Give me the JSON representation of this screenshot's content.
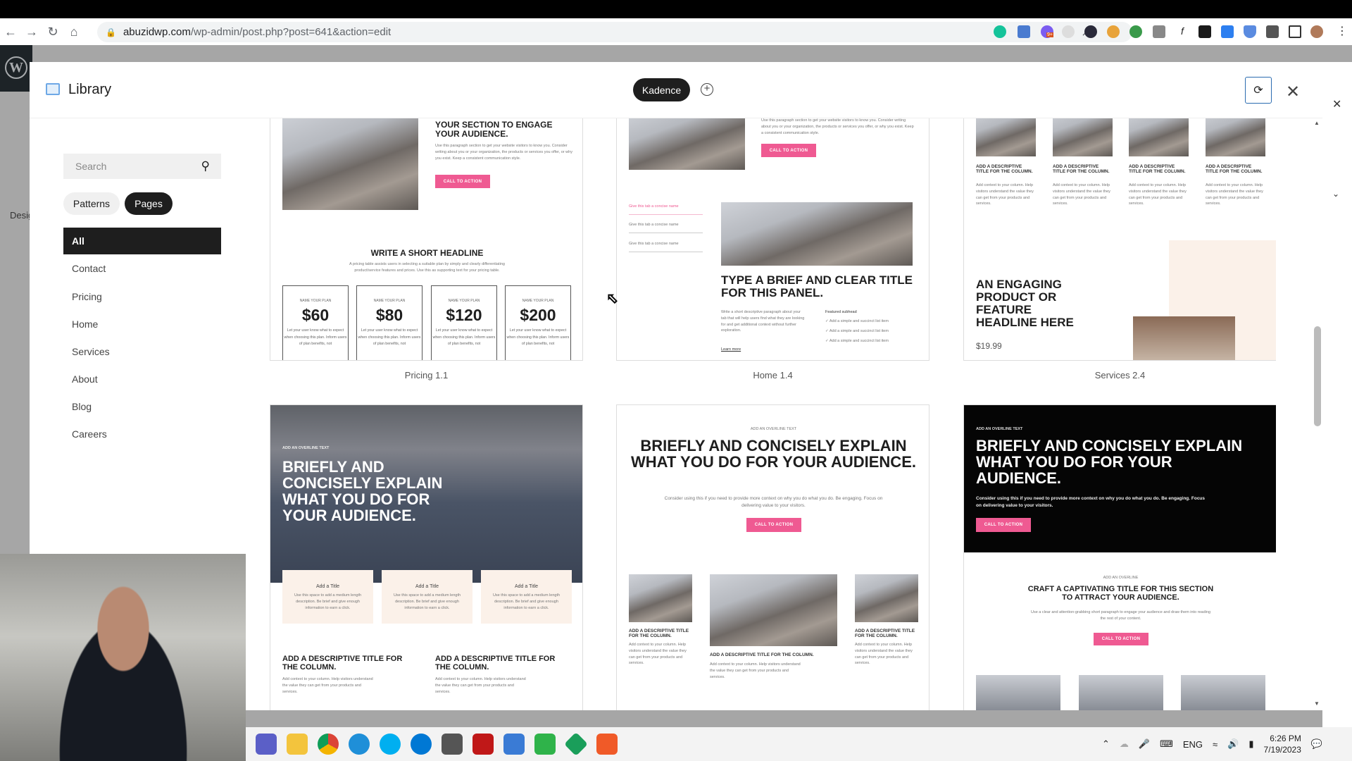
{
  "browser": {
    "url_domain": "abuzidwp.com",
    "url_path": "/wp-admin/post.php?post=641&action=edit",
    "extension_badge": "9+"
  },
  "wp": {
    "logo": "W",
    "left_fragment": "Desig"
  },
  "modal": {
    "title": "Library",
    "source_tab": "Kadence",
    "sidebar": {
      "search_placeholder": "Search",
      "toggles": [
        {
          "label": "Patterns",
          "active": false
        },
        {
          "label": "Pages",
          "active": true
        }
      ],
      "categories": [
        "All",
        "Contact",
        "Pricing",
        "Home",
        "Services",
        "About",
        "Blog",
        "Careers"
      ],
      "active_category": "All"
    },
    "cards": [
      {
        "label": "Pricing 1.1",
        "heading": "YOUR SECTION TO ENGAGE YOUR AUDIENCE.",
        "body": "Use this paragraph section to get your website visitors to know you. Consider writing about you or your organization, the products or services you offer, or why you exist. Keep a consistent communication style.",
        "cta": "CALL TO ACTION",
        "subheading": "WRITE A SHORT HEADLINE",
        "subbody": "A pricing table assists users in selecting a suitable plan by simply and clearly differentiating product/service features and prices. Use this as supporting text for your pricing table.",
        "plans": [
          {
            "name": "NAME YOUR PLAN",
            "price": "$60"
          },
          {
            "name": "NAME YOUR PLAN",
            "price": "$80"
          },
          {
            "name": "NAME YOUR PLAN",
            "price": "$120"
          },
          {
            "name": "NAME YOUR PLAN",
            "price": "$200"
          }
        ],
        "plan_desc": "Let your user know what to expect when choosing this plan. Inform users of plan benefits, not"
      },
      {
        "label": "Home 1.4",
        "body": "Use this paragraph section to get your website visitors to know you. Consider writing about you or your organization, the products or services you offer, or why you exist. Keep a consistent communication style.",
        "cta": "CALL TO ACTION",
        "tabs": [
          "Give this tab a concise name",
          "Give this tab a concise name",
          "Give this tab a concise name"
        ],
        "heading": "TYPE A BRIEF AND CLEAR TITLE FOR THIS PANEL.",
        "panel_body": "Write a short descriptive paragraph about your tab that will help users find what they are looking for and get additional context without further exploration.",
        "featured_label": "Featured subhead",
        "list_items": [
          "Add a simple and succinct list item",
          "Add a simple and succinct list item",
          "Add a simple and succinct list item"
        ],
        "link": "Learn more"
      },
      {
        "label": "Services 2.4",
        "column_title": "ADD A DESCRIPTIVE TITLE FOR THE COLUMN.",
        "column_body": "Add context to your column. Help visitors understand the value they can get from your products and services.",
        "heading": "AN ENGAGING PRODUCT OR FEATURE HEADLINE HERE",
        "price": "$19.99"
      },
      {
        "overline": "ADD AN OVERLINE TEXT",
        "heading": "BRIEFLY AND CONCISELY EXPLAIN WHAT YOU DO FOR YOUR AUDIENCE.",
        "feature_title": "Add a Title",
        "feature_body": "Use this space to add a medium length description. Be brief and give enough information to earn a click.",
        "column_title": "ADD A DESCRIPTIVE TITLE FOR THE COLUMN.",
        "column_body": "Add context to your column. Help visitors understand the value they can get from your products and services."
      },
      {
        "overline": "ADD AN OVERLINE TEXT",
        "heading": "BRIEFLY AND CONCISELY EXPLAIN WHAT YOU DO FOR YOUR AUDIENCE.",
        "body": "Consider using this if you need to provide more context on why you do what you do. Be engaging. Focus on delivering value to your visitors.",
        "cta": "CALL TO ACTION",
        "column_title": "ADD A DESCRIPTIVE TITLE FOR THE COLUMN.",
        "column_body": "Add context to your column. Help visitors understand the value they can get from your products and services."
      },
      {
        "overline": "ADD AN OVERLINE TEXT",
        "heading": "BRIEFLY AND CONCISELY EXPLAIN WHAT YOU DO FOR YOUR AUDIENCE.",
        "body": "Consider using this if you need to provide more context on why you do what you do. Be engaging. Focus on delivering value to your visitors.",
        "cta": "CALL TO ACTION",
        "overline2": "ADD AN OVERLINE",
        "heading2": "CRAFT A CAPTIVATING TITLE FOR THIS SECTION TO ATTRACT YOUR AUDIENCE.",
        "body2": "Use a clear and attention-grabbing short paragraph to engage your audience and draw them into reading the rest of your content.",
        "cta2": "CALL TO ACTION"
      }
    ]
  },
  "taskbar": {
    "language": "ENG",
    "time": "6:26 PM",
    "date": "7/19/2023"
  }
}
